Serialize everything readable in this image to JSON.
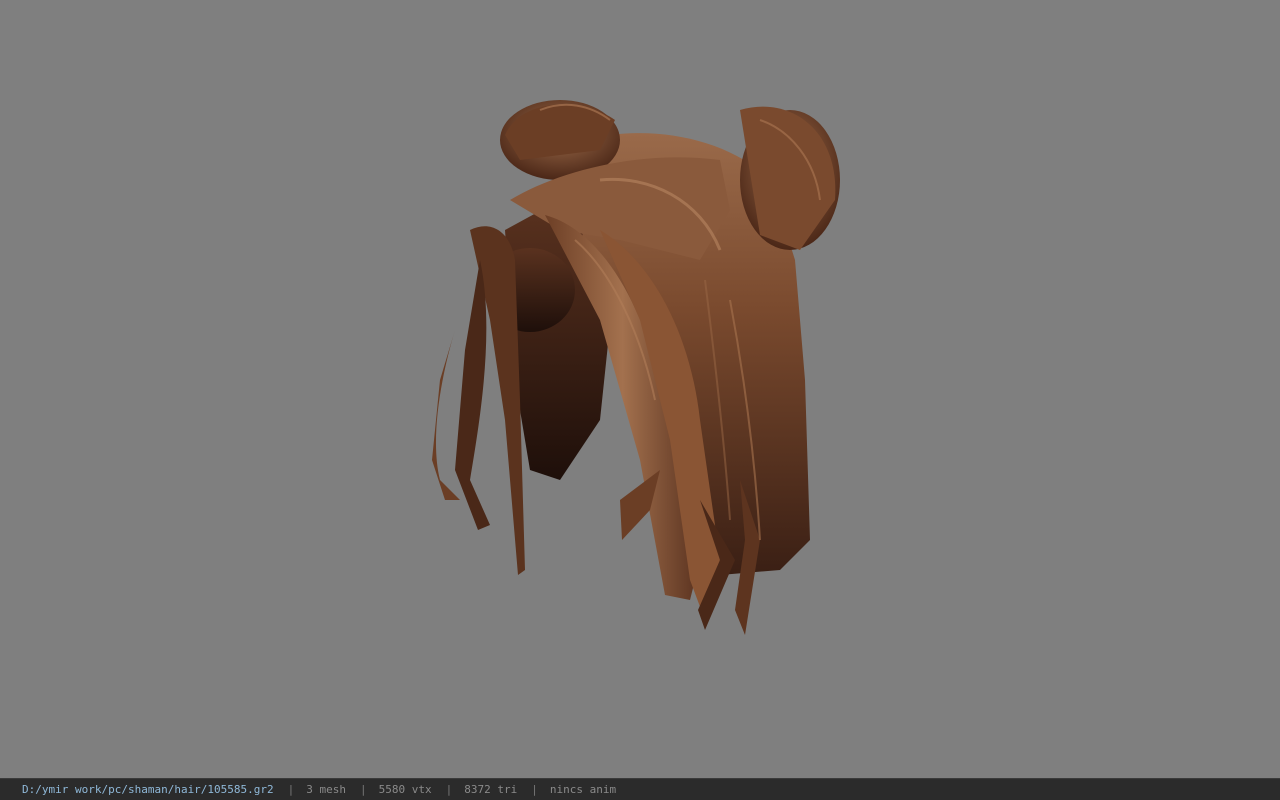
{
  "viewer": {
    "background_color": "#7f7f7f",
    "model_icon": "hair-model"
  },
  "status": {
    "file_path": "D:/ymir work/pc/shaman/hair/105585.gr2",
    "separator": "|",
    "mesh": "3 mesh",
    "vertices": "5580 vtx",
    "triangles": "8372 tri",
    "anim": "nincs anim"
  }
}
